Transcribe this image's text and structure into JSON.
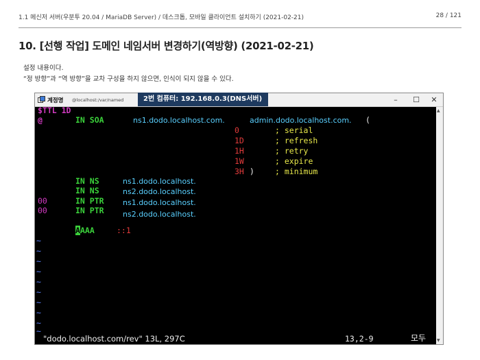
{
  "header": {
    "breadcrumb": "1.1 메신저 서버(우분투 20.04 / MariaDB Server) / 데스크톱, 모바일 클라이언트 설치하기 (2021-02-21)",
    "page_number": "28 / 121"
  },
  "section": {
    "title": "10. [선행 작업] 도메인 네임서버 변경하기(역방향) (2021-02-21)",
    "desc_line1": "설정 내용이다.",
    "desc_line2": "“정 방향”과 “역 방향”을 교차 구성을 하지 않으면, 인식이 되지 않을 수 있다."
  },
  "window": {
    "app_name": "계정명",
    "path": "@localhost:/var/named",
    "callout": "2번 컴퓨터: 192.168.0.3(DNS서버)",
    "minimize": "–",
    "maximize": "☐",
    "close": "✕"
  },
  "editor": {
    "ttl": "$TTL 1D",
    "at": "@",
    "in_soa": "IN SOA",
    "soa_ns": "ns1.dodo.localhost.com.",
    "soa_admin": "admin.dodo.localhost.com.",
    "paren_open": "(",
    "serial_val": "0",
    "refresh_val": "1D",
    "retry_val": "1H",
    "expire_val": "1W",
    "minimum_val": "3H",
    "paren_close": ")",
    "serial_lbl": "; serial",
    "refresh_lbl": "; refresh",
    "retry_lbl": "; retry",
    "expire_lbl": "; expire",
    "minimum_lbl": "; minimum",
    "in_ns": "IN NS",
    "in_ptr": "IN PTR",
    "ns1": "ns1.dodo.localhost.",
    "ns2": "ns2.dodo.localhost.",
    "ptr_num": "00",
    "aaaa_first": "A",
    "aaaa_rest": "AAA",
    "aaaa_addr": "::1",
    "tilde": "~",
    "status_file": "\"dodo.localhost.com/rev\" 13L, 297C",
    "status_pos": "13,2-9",
    "status_all": "모두"
  }
}
